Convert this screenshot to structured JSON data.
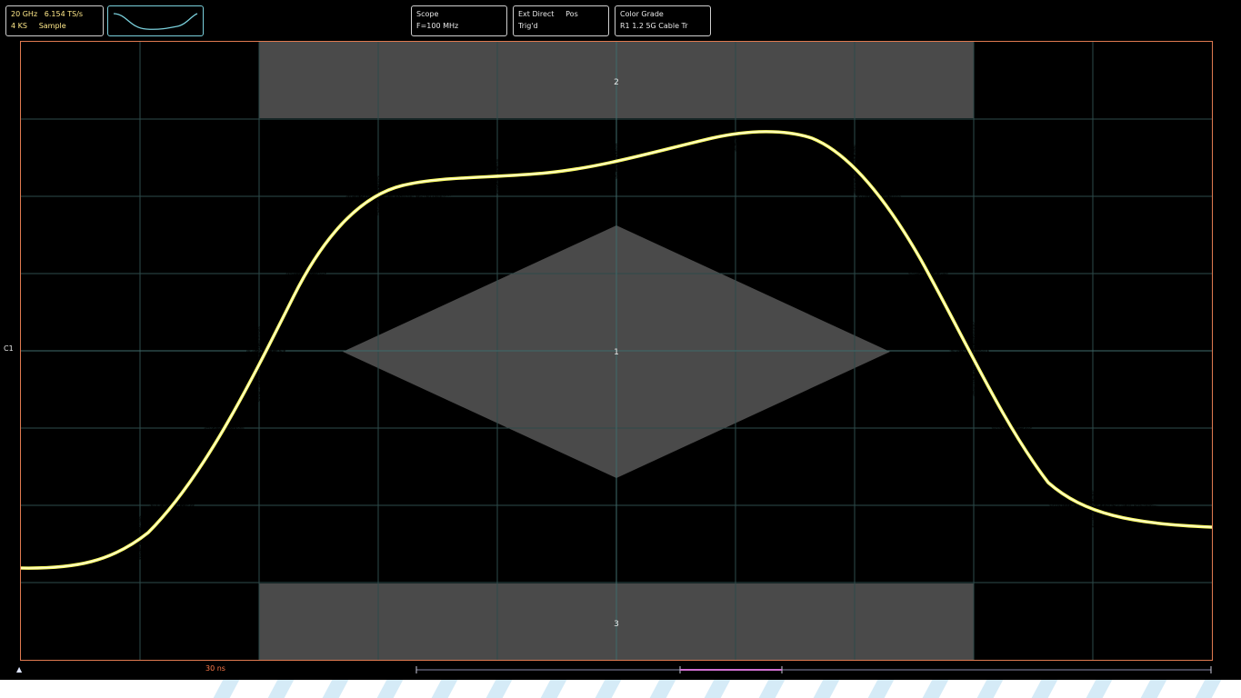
{
  "acquisition": {
    "bandwidth": "20 GHz",
    "sample_rate": "6.154 TS/s",
    "points": "4 KS",
    "mode": "Sample"
  },
  "scope_box": {
    "line1": "Scope",
    "line2": "F=100 MHz"
  },
  "trigger_box": {
    "line1": "Ext Direct",
    "line1b": "Pos",
    "line2": "Trig'd"
  },
  "display_box": {
    "line1": "Color Grade",
    "line2": "R1 1.2 5G Cable Tr"
  },
  "channel_label": "C1",
  "timebase_label": "30 ns",
  "mask_labels": {
    "top": "2",
    "center": "1",
    "bottom": "3"
  },
  "colors": {
    "background": "#000000",
    "grid": "#2f4f4f",
    "border": "#e07a50",
    "mask": "#4a4a4a",
    "density_low": "#15c21a",
    "density_mid": "#3b3bf0",
    "density_high": "#ff4040",
    "density_peak": "#ffff6a"
  },
  "icons": {
    "waveform_thumbnail": "waveform-thumbnail-icon",
    "trigger_marker": "trigger-marker-icon"
  }
}
